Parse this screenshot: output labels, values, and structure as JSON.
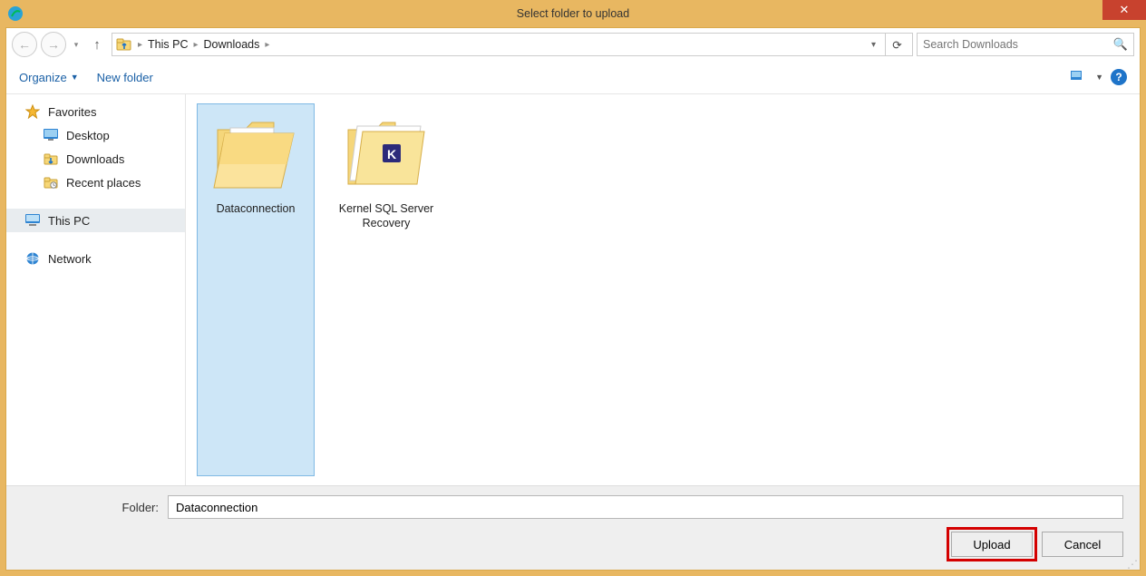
{
  "window": {
    "title": "Select folder to upload"
  },
  "nav": {
    "breadcrumb": [
      "This PC",
      "Downloads"
    ],
    "search_placeholder": "Search Downloads"
  },
  "toolbar": {
    "organize": "Organize",
    "new_folder": "New folder"
  },
  "sidebar": {
    "favorites": "Favorites",
    "desktop": "Desktop",
    "downloads": "Downloads",
    "recent": "Recent places",
    "this_pc": "This PC",
    "network": "Network"
  },
  "folders": [
    {
      "name": "Dataconnection",
      "selected": true,
      "subicon": null
    },
    {
      "name": "Kernel SQL Server Recovery",
      "selected": false,
      "subicon": "K"
    }
  ],
  "footer": {
    "label": "Folder:",
    "value": "Dataconnection",
    "upload": "Upload",
    "cancel": "Cancel"
  }
}
